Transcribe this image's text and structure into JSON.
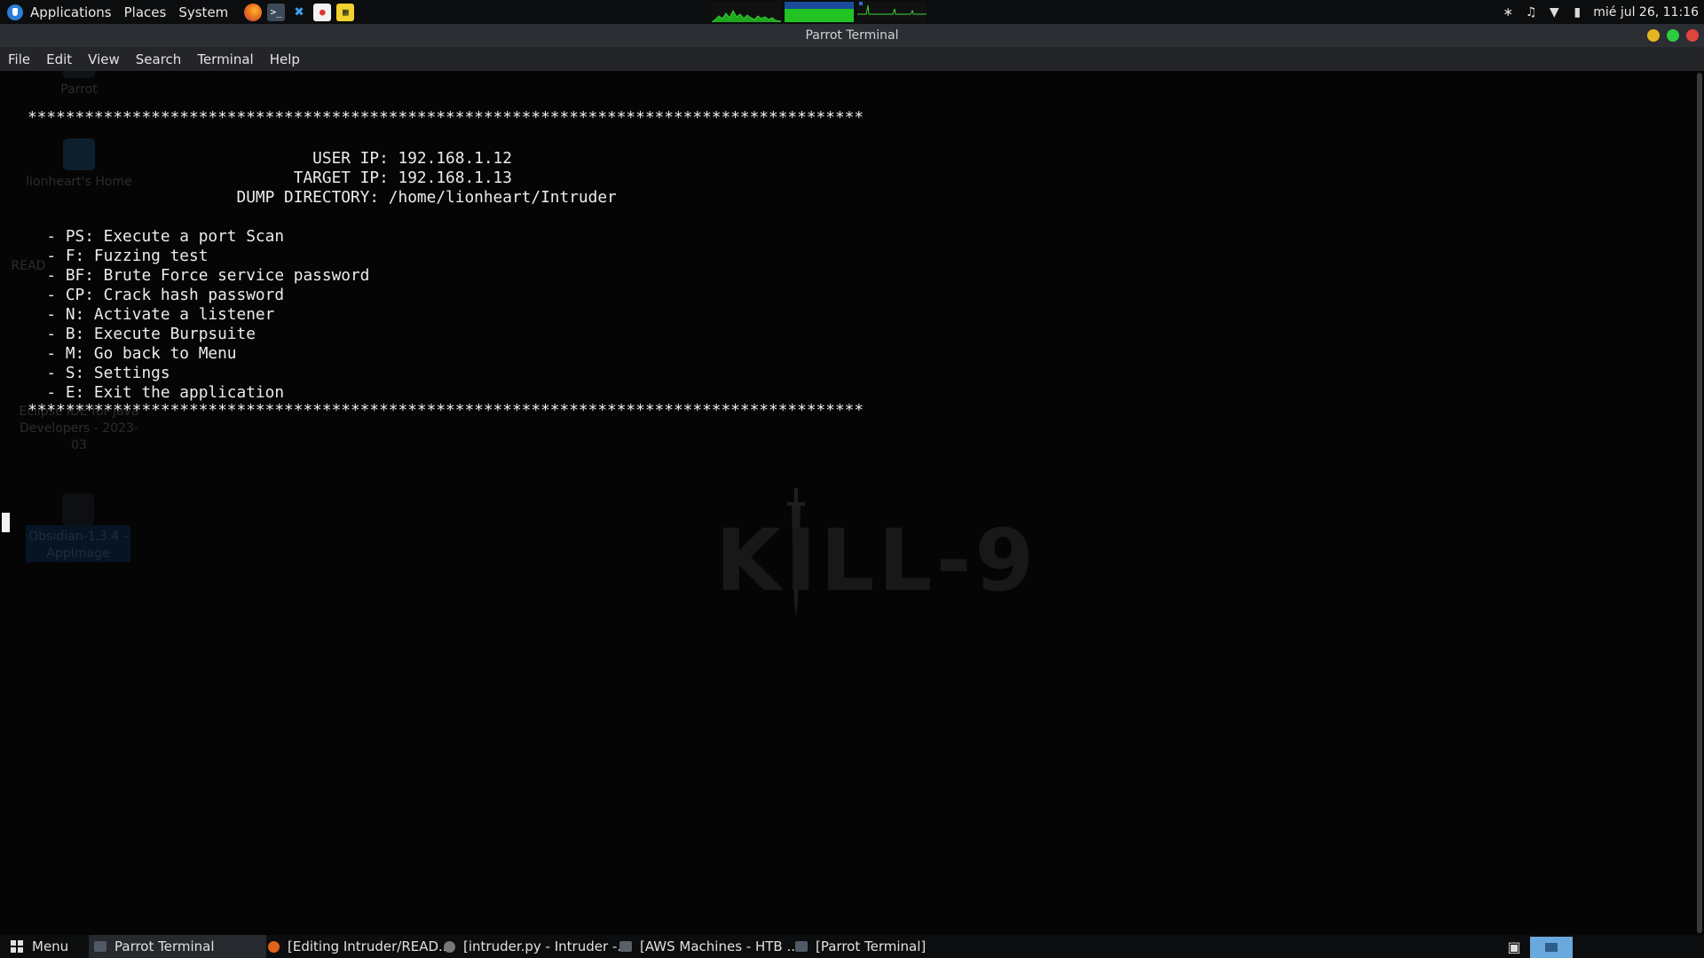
{
  "top_panel": {
    "menus": [
      "Applications",
      "Places",
      "System"
    ],
    "datetime": "mié jul 26, 11:16",
    "launchers": [
      "firefox-icon",
      "terminal-icon",
      "vscode-icon",
      "text-editor-icon",
      "screenshot-icon"
    ]
  },
  "window": {
    "title": "Parrot Terminal",
    "menu": [
      "File",
      "Edit",
      "View",
      "Search",
      "Terminal",
      "Help"
    ]
  },
  "desktop_icons": [
    "Parrot",
    "lionheart's Home",
    "READ",
    "Eclipse IDE for Java Developers - 2023-03",
    "Obsidian-1.3.4 - AppImage"
  ],
  "terminal": {
    "border_line": "****************************************************************************************",
    "user_ip": "                              USER IP: 192.168.1.12",
    "target_ip": "                            TARGET IP: 192.168.1.13",
    "dump_dir": "                      DUMP DIRECTORY: /home/lionheart/Intruder",
    "options": [
      "  - PS: Execute a port Scan",
      "  - F: Fuzzing test",
      "  - BF: Brute Force service password",
      "  - CP: Crack hash password",
      "  - N: Activate a listener",
      "  - B: Execute Burpsuite",
      "  - M: Go back to Menu",
      "  - S: Settings",
      "  - E: Exit the application"
    ],
    "watermark": "KILL-9"
  },
  "taskbar": {
    "menu_label": "Menu",
    "items": [
      "Parrot Terminal",
      "[Editing Intruder/READ...",
      "[intruder.py - Intruder -...",
      "[AWS Machines - HTB ...",
      "[Parrot Terminal]"
    ]
  },
  "colors": {
    "panel_bg": "#0c0d0e",
    "terminal_bg": "#050505",
    "accent": "#2a7fd6",
    "close": "#e0443e",
    "minimize": "#e6b422",
    "maximize": "#2ecc40"
  }
}
